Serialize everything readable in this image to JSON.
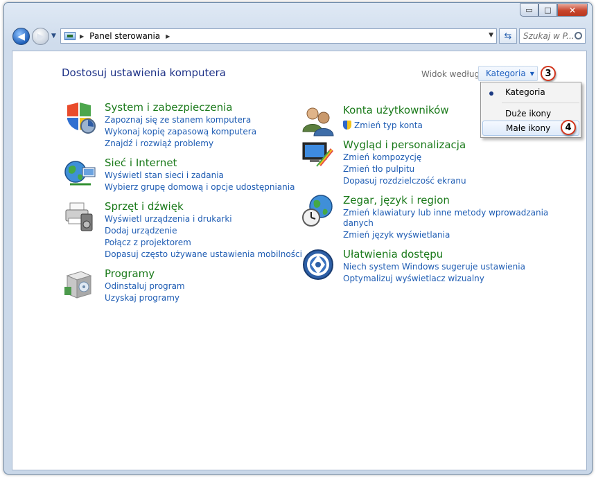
{
  "window": {
    "controls": {
      "minimize": "▭",
      "maximize": "□",
      "close": "✕"
    }
  },
  "toolbar": {
    "address_path": [
      "Panel sterowania"
    ],
    "search_placeholder": "Szukaj w P...",
    "back_icon": "arrow-left-icon",
    "forward_icon": "arrow-right-icon",
    "refresh_icon": "refresh-icon"
  },
  "header": {
    "title": "Dostosuj ustawienia komputera",
    "view_label": "Widok według:",
    "view_value": "Kategoria"
  },
  "view_menu": {
    "options": [
      "Kategoria",
      "Duże ikony",
      "Małe ikony"
    ],
    "selected_index": 0,
    "hovered_index": 2
  },
  "annotations": {
    "step3": "3",
    "step4": "4"
  },
  "categories_left": [
    {
      "title": "System i zabezpieczenia",
      "icon": "shield-icon",
      "links": [
        "Zapoznaj się ze stanem komputera",
        "Wykonaj kopię zapasową komputera",
        "Znajdź i rozwiąż problemy"
      ]
    },
    {
      "title": "Sieć i Internet",
      "icon": "network-globe-icon",
      "links": [
        "Wyświetl stan sieci i zadania",
        "Wybierz grupę domową i opcje udostępniania"
      ]
    },
    {
      "title": "Sprzęt i dźwięk",
      "icon": "printer-speaker-icon",
      "links": [
        "Wyświetl urządzenia i drukarki",
        "Dodaj urządzenie",
        "Połącz z projektorem",
        "Dopasuj często używane ustawienia mobilności"
      ]
    },
    {
      "title": "Programy",
      "icon": "programs-box-icon",
      "links": [
        "Odinstaluj program",
        "Uzyskaj programy"
      ]
    }
  ],
  "categories_right": [
    {
      "title": "Konta użytkowników",
      "icon": "users-icon",
      "links": [
        "Zmień typ konta"
      ]
    },
    {
      "title": "Wygląd i personalizacja",
      "icon": "monitor-paint-icon",
      "links": [
        "Zmień kompozycję",
        "Zmień tło pulpitu",
        "Dopasuj rozdzielczość ekranu"
      ]
    },
    {
      "title": "Zegar, język i region",
      "icon": "clock-globe-icon",
      "links": [
        "Zmień klawiatury lub inne metody wprowadzania",
        "danych",
        "Zmień język wyświetlania"
      ]
    },
    {
      "title": "Ułatwienia dostępu",
      "icon": "accessibility-icon",
      "links": [
        "Niech system Windows sugeruje ustawienia",
        "Optymalizuj wyświetlacz wizualny"
      ]
    }
  ]
}
